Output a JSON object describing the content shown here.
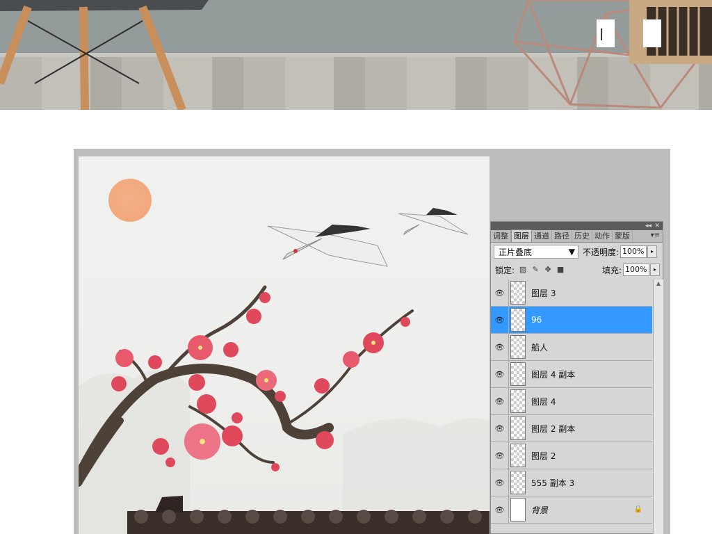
{
  "panel": {
    "tabs": [
      "调整",
      "图层",
      "通道",
      "路径",
      "历史",
      "动作",
      "蒙版"
    ],
    "active_tab": "图层",
    "blend_mode": "正片叠底",
    "opacity_label": "不透明度:",
    "opacity_value": "100%",
    "lock_label": "锁定:",
    "fill_label": "填充:",
    "fill_value": "100%",
    "layers": [
      {
        "name": "图层 3",
        "selected": false
      },
      {
        "name": "96",
        "selected": true
      },
      {
        "name": "船人",
        "selected": false
      },
      {
        "name": "图层 4 副本",
        "selected": false
      },
      {
        "name": "图层 4",
        "selected": false
      },
      {
        "name": "图层 2 副本",
        "selected": false
      },
      {
        "name": "图层 2",
        "selected": false
      },
      {
        "name": "555 副本 3",
        "selected": false
      },
      {
        "name": "背景",
        "selected": false
      }
    ]
  },
  "colors": {
    "selection": "#3399ff",
    "panel_bg": "#d6d6d6",
    "workspace": "#bdbdbd"
  },
  "icons": [
    "eye-icon",
    "lock-icon",
    "move-icon",
    "brush-icon",
    "dropdown-arrow-icon",
    "panel-menu-icon"
  ]
}
